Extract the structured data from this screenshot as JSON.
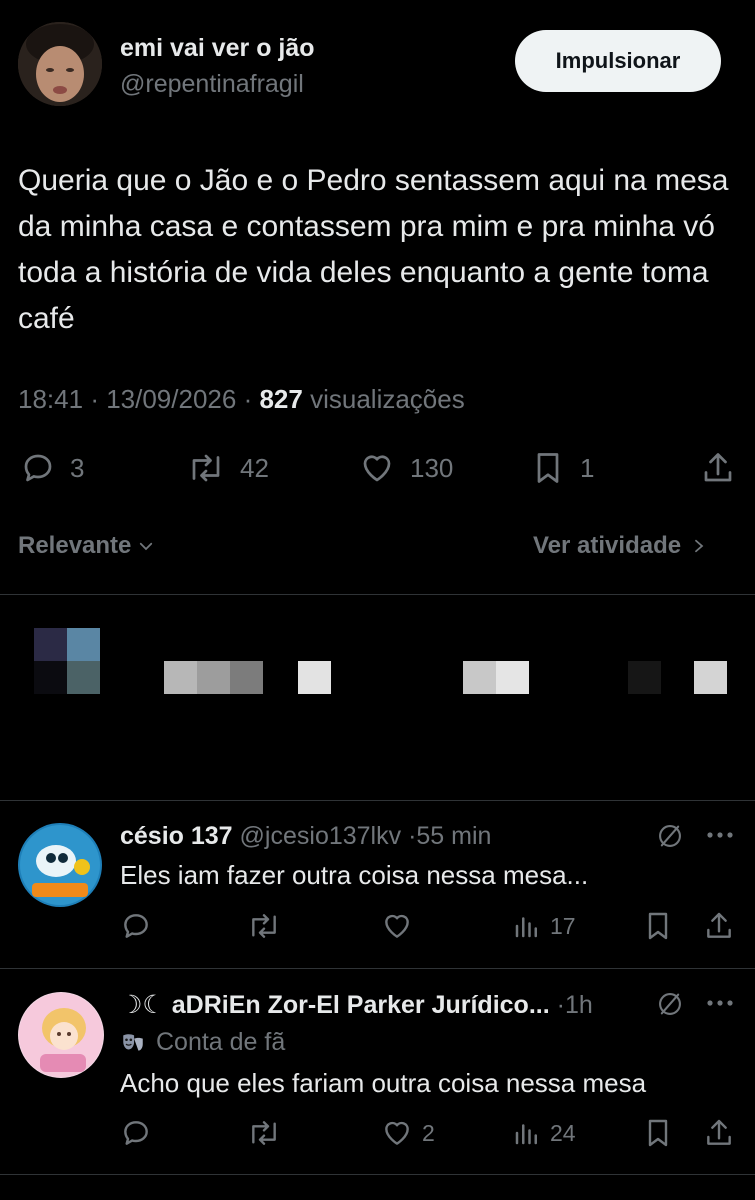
{
  "post": {
    "author_name": "emi vai ver o jão",
    "author_handle": "@repentinafragil",
    "boost_label": "Impulsionar",
    "text": "Queria que o Jão e o Pedro sentassem aqui na mesa da minha casa e contassem pra mim e pra minha vó toda a história de vida deles enquanto a gente toma café",
    "time": "18:41",
    "date": "13/09/2026",
    "views_count": "827",
    "views_label": "visualizações",
    "stats": {
      "replies": "3",
      "reposts": "42",
      "likes": "130",
      "bookmarks": "1"
    }
  },
  "filter": {
    "sort_label": "Relevante",
    "activity_label": "Ver atividade"
  },
  "replies": [
    {
      "name": "césio 137",
      "handle": "@jcesio137lkv",
      "time": "55 min",
      "badge": "",
      "text": "Eles iam fazer outra coisa nessa mesa...",
      "likes": "",
      "views": "17"
    },
    {
      "name": "☽☾ aDRiEn Zor-El Parker Jurídico...",
      "handle": "",
      "time": "1h",
      "badge": "Conta de fã",
      "text": "Acho que eles fariam outra coisa nessa mesa",
      "likes": "2",
      "views": "24"
    }
  ],
  "colors": {
    "background": "#000000",
    "text": "#e7e9ea",
    "muted": "#71767b",
    "divider": "#2f3336"
  }
}
